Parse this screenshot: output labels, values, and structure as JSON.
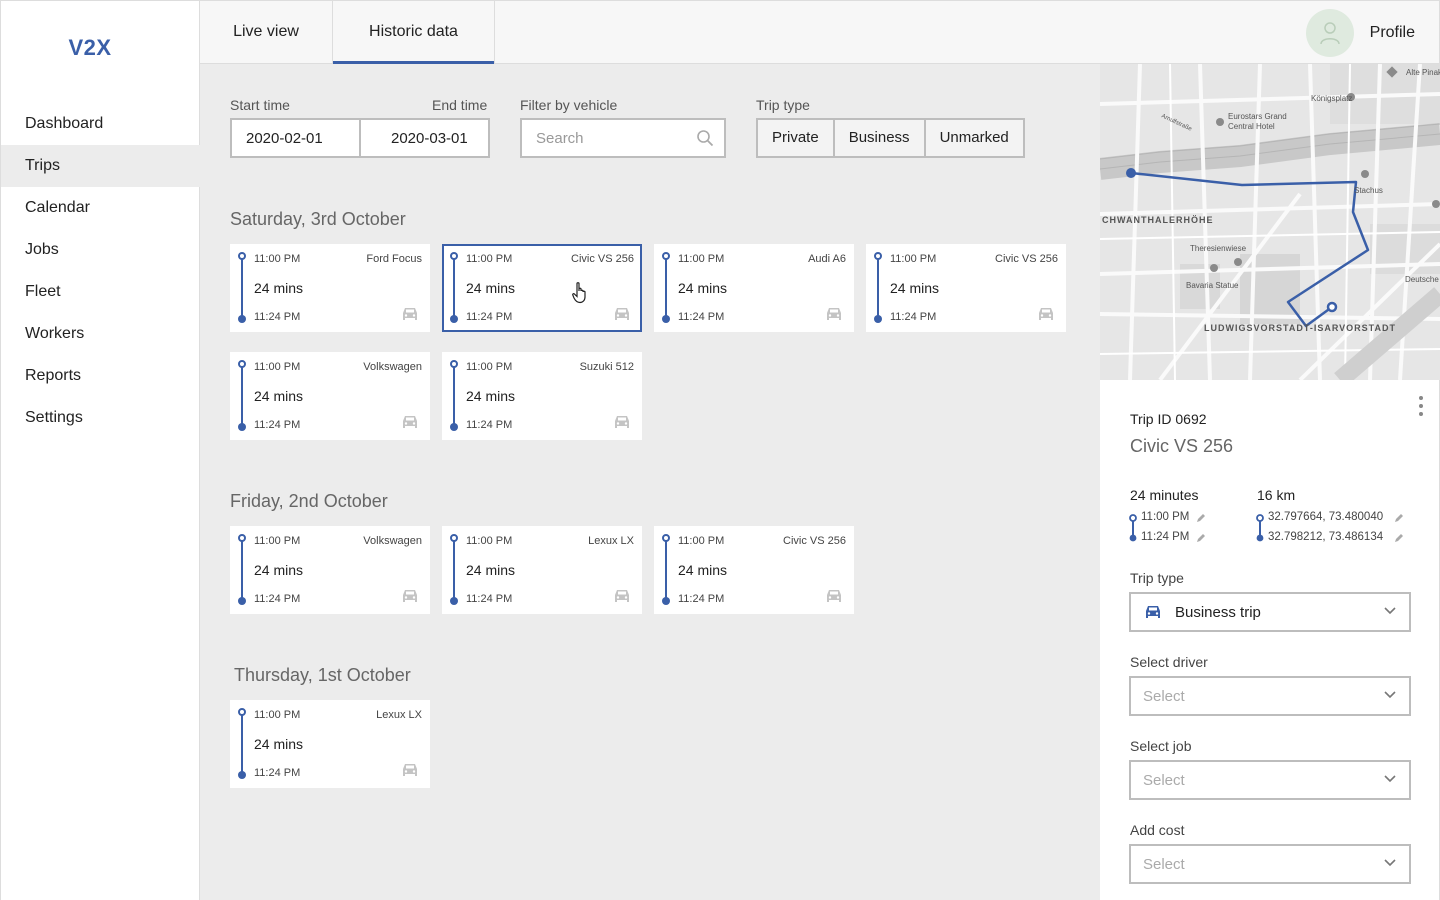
{
  "app": {
    "logo": "V2X"
  },
  "sidebar": {
    "items": [
      {
        "label": "Dashboard"
      },
      {
        "label": "Trips"
      },
      {
        "label": "Calendar"
      },
      {
        "label": "Jobs"
      },
      {
        "label": "Fleet"
      },
      {
        "label": "Workers"
      },
      {
        "label": "Reports"
      },
      {
        "label": "Settings"
      }
    ],
    "active": "Trips"
  },
  "tabs": [
    {
      "label": "Live view"
    },
    {
      "label": "Historic data"
    }
  ],
  "profile": {
    "label": "Profile"
  },
  "filters": {
    "start_label": "Start time",
    "end_label": "End time",
    "start_value": "2020-02-01",
    "end_value": "2020-03-01",
    "vehicle_label": "Filter by vehicle",
    "vehicle_placeholder": "Search",
    "trip_type_label": "Trip type",
    "trip_types": [
      "Private",
      "Business",
      "Unmarked"
    ]
  },
  "days": [
    {
      "title": "Saturday, 3rd October",
      "trips": [
        {
          "start": "11:00 PM",
          "end": "11:24 PM",
          "duration": "24 mins",
          "vehicle": "Ford Focus"
        },
        {
          "start": "11:00 PM",
          "end": "11:24 PM",
          "duration": "24 mins",
          "vehicle": "Civic VS 256"
        },
        {
          "start": "11:00 PM",
          "end": "11:24 PM",
          "duration": "24 mins",
          "vehicle": "Audi A6"
        },
        {
          "start": "11:00 PM",
          "end": "11:24 PM",
          "duration": "24 mins",
          "vehicle": "Civic VS 256"
        },
        {
          "start": "11:00 PM",
          "end": "11:24 PM",
          "duration": "24 mins",
          "vehicle": "Volkswagen"
        },
        {
          "start": "11:00 PM",
          "end": "11:24 PM",
          "duration": "24 mins",
          "vehicle": "Suzuki 512"
        }
      ]
    },
    {
      "title": "Friday, 2nd October",
      "trips": [
        {
          "start": "11:00 PM",
          "end": "11:24 PM",
          "duration": "24 mins",
          "vehicle": "Volkswagen"
        },
        {
          "start": "11:00 PM",
          "end": "11:24 PM",
          "duration": "24 mins",
          "vehicle": "Lexux LX"
        },
        {
          "start": "11:00 PM",
          "end": "11:24 PM",
          "duration": "24 mins",
          "vehicle": "Civic VS 256"
        }
      ]
    },
    {
      "title": "Thursday, 1st October",
      "trips": [
        {
          "start": "11:00 PM",
          "end": "11:24 PM",
          "duration": "24 mins",
          "vehicle": "Lexux LX"
        }
      ]
    }
  ],
  "map": {
    "labels": [
      "Alte Pinak",
      "Königsplatz",
      "Eurostars Grand",
      "Central Hotel",
      "Stachus",
      "CHWANTHALERHÖHE",
      "Theresienwiese",
      "Bavaria Statue",
      "Deutsche",
      "LUDWIGSVORSTADT-ISARVORSTADT",
      "Arnulfstraße"
    ]
  },
  "detail": {
    "trip_id": "Trip ID 0692",
    "vehicle": "Civic VS 256",
    "duration": "24 minutes",
    "distance": "16 km",
    "start_time": "11:00 PM",
    "end_time": "11:24 PM",
    "start_coord": "32.797664, 73.480040",
    "end_coord": "32.798212, 73.486134",
    "trip_type_label": "Trip type",
    "trip_type_value": "Business trip",
    "driver_label": "Select driver",
    "driver_placeholder": "Select",
    "job_label": "Select job",
    "job_placeholder": "Select",
    "cost_label": "Add cost",
    "cost_placeholder": "Select"
  },
  "colors": {
    "accent": "#3a5fa8",
    "background": "#ececec"
  }
}
